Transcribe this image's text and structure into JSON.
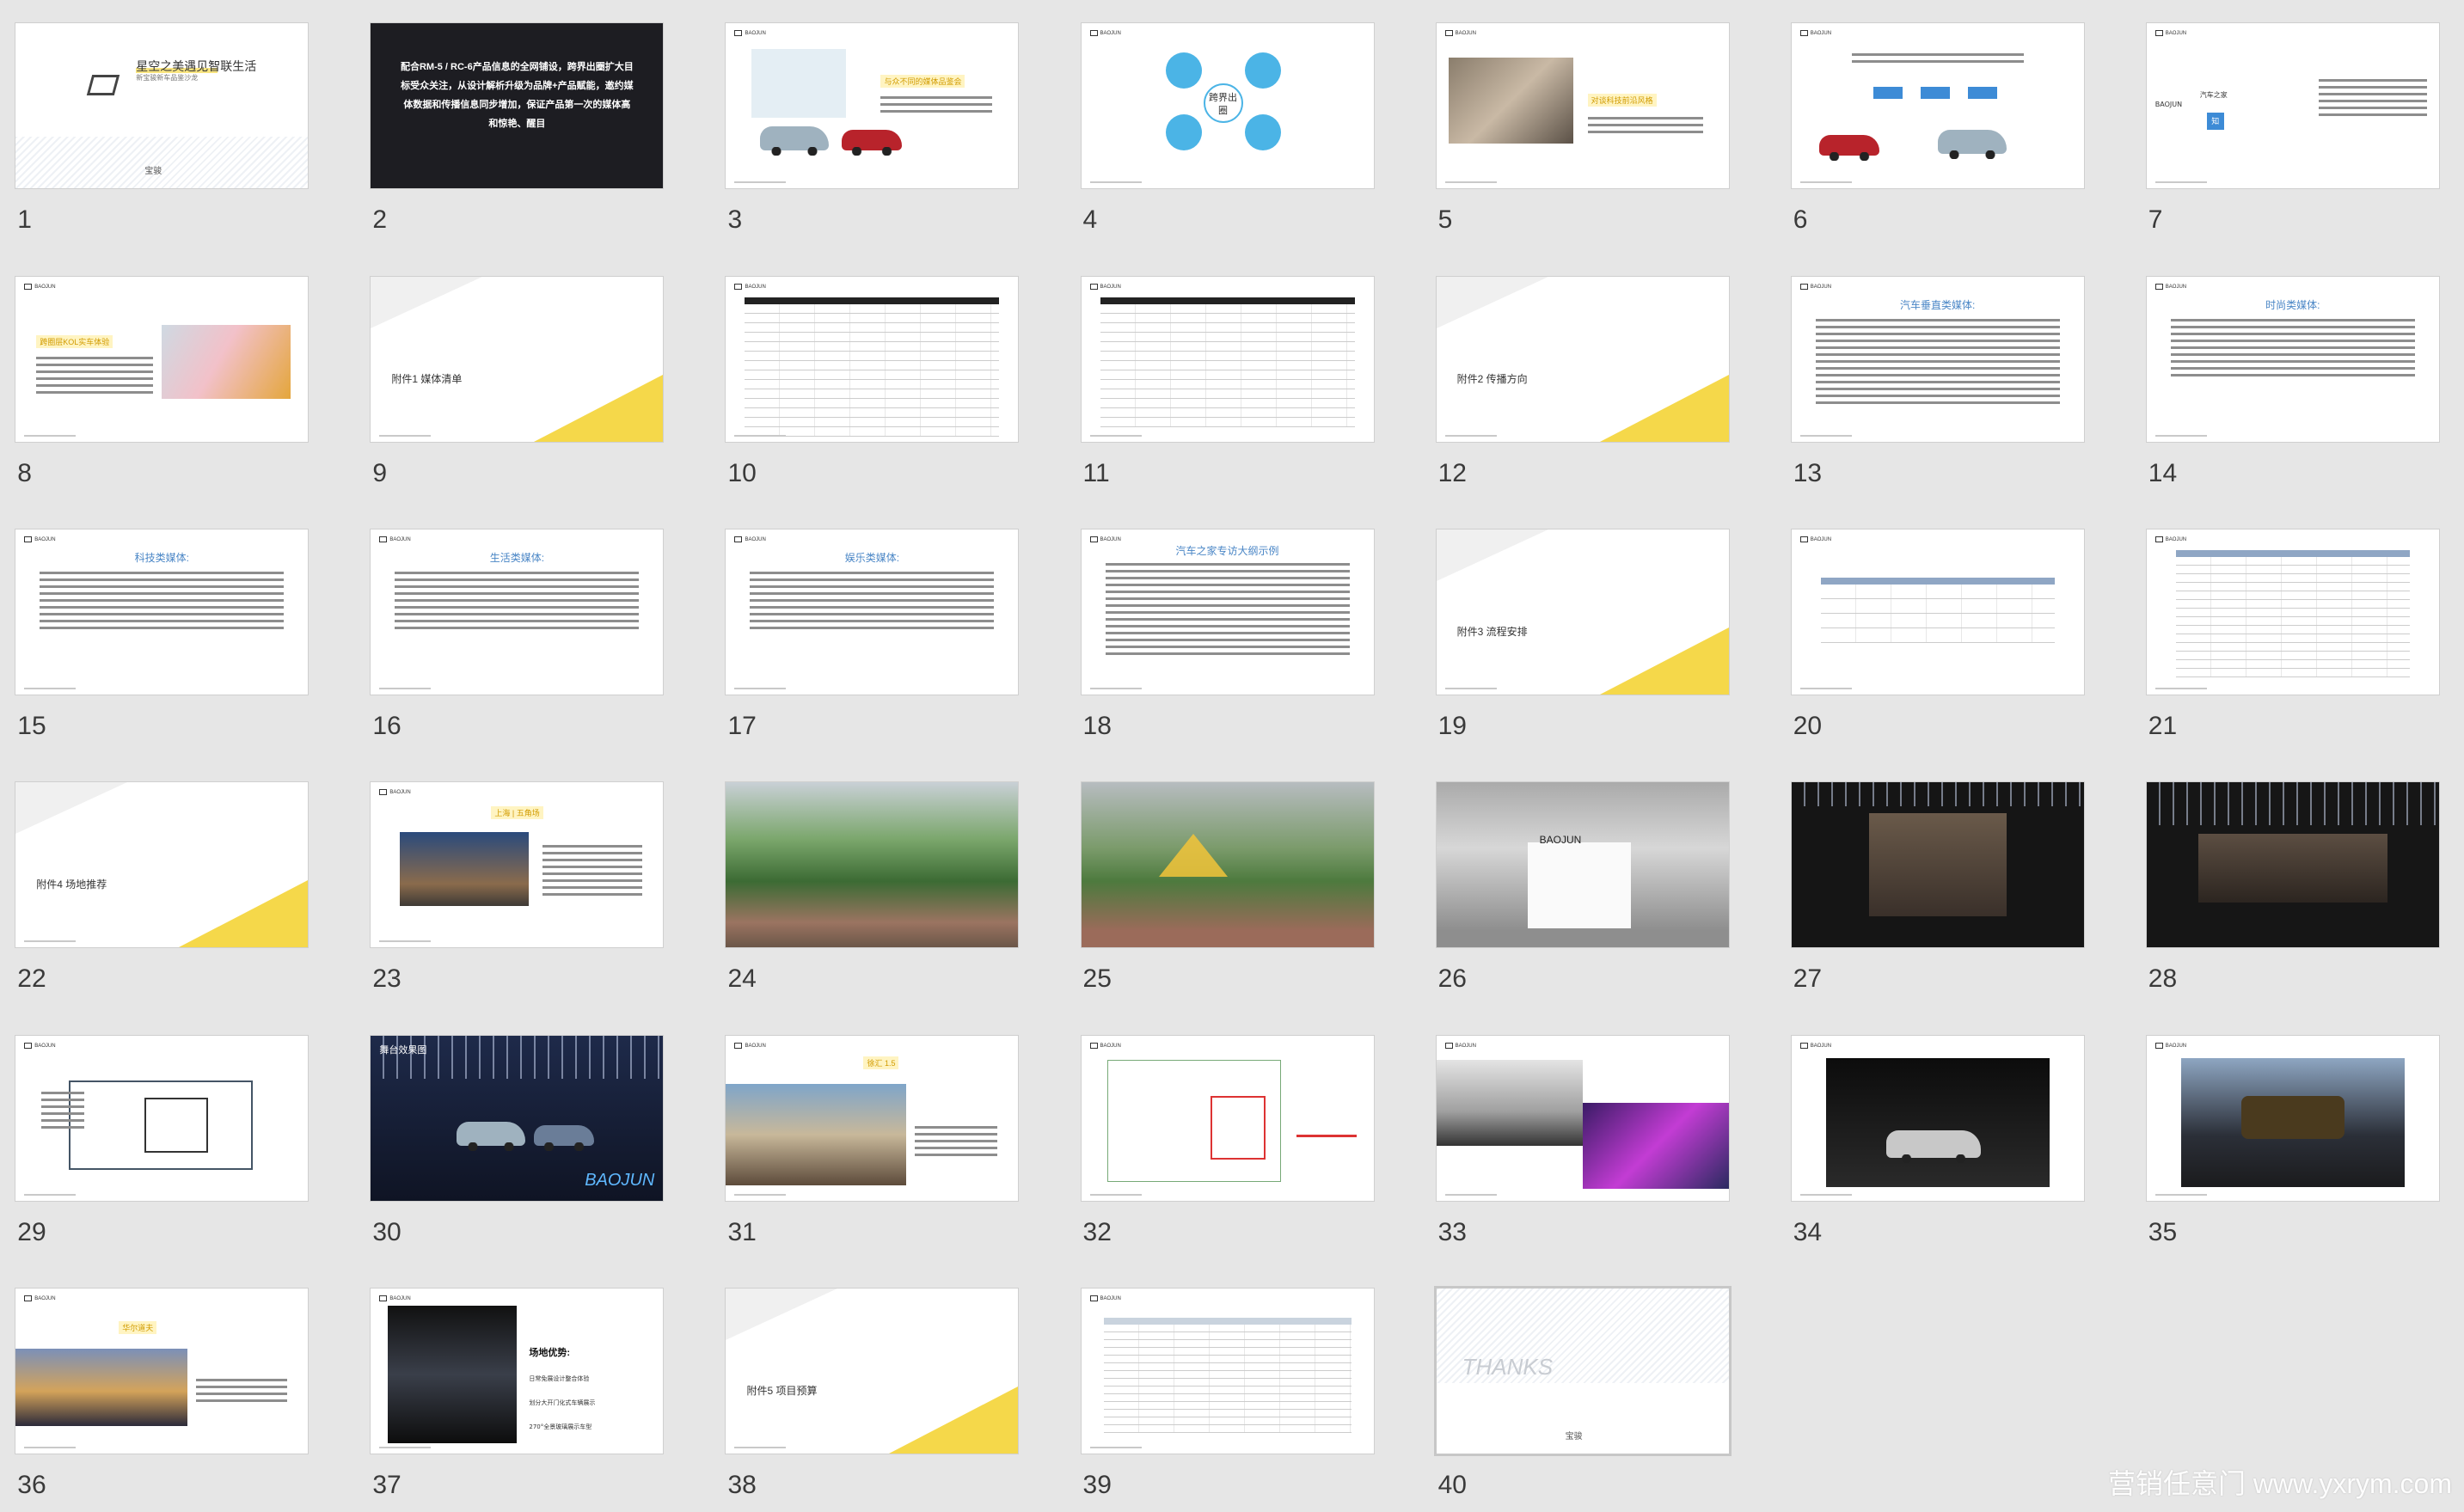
{
  "slides": [
    {
      "n": "1"
    },
    {
      "n": "2"
    },
    {
      "n": "3"
    },
    {
      "n": "4"
    },
    {
      "n": "5"
    },
    {
      "n": "6"
    },
    {
      "n": "7"
    },
    {
      "n": "8"
    },
    {
      "n": "9"
    },
    {
      "n": "10"
    },
    {
      "n": "11"
    },
    {
      "n": "12"
    },
    {
      "n": "13"
    },
    {
      "n": "14"
    },
    {
      "n": "15"
    },
    {
      "n": "16"
    },
    {
      "n": "17"
    },
    {
      "n": "18"
    },
    {
      "n": "19"
    },
    {
      "n": "20"
    },
    {
      "n": "21"
    },
    {
      "n": "22"
    },
    {
      "n": "23"
    },
    {
      "n": "24"
    },
    {
      "n": "25"
    },
    {
      "n": "26"
    },
    {
      "n": "27"
    },
    {
      "n": "28"
    },
    {
      "n": "29"
    },
    {
      "n": "30"
    },
    {
      "n": "31"
    },
    {
      "n": "32"
    },
    {
      "n": "33"
    },
    {
      "n": "34"
    },
    {
      "n": "35"
    },
    {
      "n": "36"
    },
    {
      "n": "37"
    },
    {
      "n": "38"
    },
    {
      "n": "39"
    },
    {
      "n": "40"
    }
  ],
  "s1": {
    "title": "星空之美遇见智联生活",
    "sub": "新宝骏新车品鉴沙龙",
    "brand": "宝骏"
  },
  "s2": {
    "text": "配合RM-5 / RC-6产品信息的全网铺设，跨界出圈扩大目标受众关注，从设计解析升级为品牌+产品赋能，邀约媒体数据和传播信息同步增加，保证产品第一次的媒体高和惊艳、醒目"
  },
  "s3": {
    "title": "与众不同的媒体品鉴会"
  },
  "s4": {
    "center": "跨界出圈"
  },
  "s5": {
    "title": "对谈科技前沿风格"
  },
  "s7": {
    "t1": "汽车之家",
    "t2": "知"
  },
  "s8": {
    "title": "跨圈层KOL实车体验"
  },
  "s9": {
    "title": "附件1 媒体清单"
  },
  "s12": {
    "title": "附件2 传播方向"
  },
  "s13": {
    "title": "汽车垂直类媒体:"
  },
  "s14": {
    "title": "时尚类媒体:"
  },
  "s15": {
    "title": "科技类媒体:"
  },
  "s16": {
    "title": "生活类媒体:"
  },
  "s17": {
    "title": "娱乐类媒体:"
  },
  "s18": {
    "title": "汽车之家专访大纲示例"
  },
  "s19": {
    "title": "附件3 流程安排"
  },
  "s22": {
    "title": "附件4 场地推荐"
  },
  "s23": {
    "title": "上海 | 五角场"
  },
  "s26": {
    "brand": "BAOJUN"
  },
  "s30": {
    "title": "舞台效果图",
    "brand": "BAOJUN"
  },
  "s31": {
    "title": "徐汇 1.5"
  },
  "s36": {
    "title": "华尔道夫"
  },
  "s37": {
    "title": "场地优势:",
    "l1": "日常免展设计整合体验",
    "l2": "划分大开门化式车辆展示",
    "l3": "270°全景玻璃展示车型"
  },
  "s38": {
    "title": "附件5 项目预算"
  },
  "s40": {
    "title": "THANKS",
    "brand": "宝骏"
  },
  "watermark": "营销任意门 www.yxrym.com",
  "colors": {
    "accent": "#f5d84a",
    "blue": "#4bb4e6",
    "brandblue": "#4a86c6"
  }
}
